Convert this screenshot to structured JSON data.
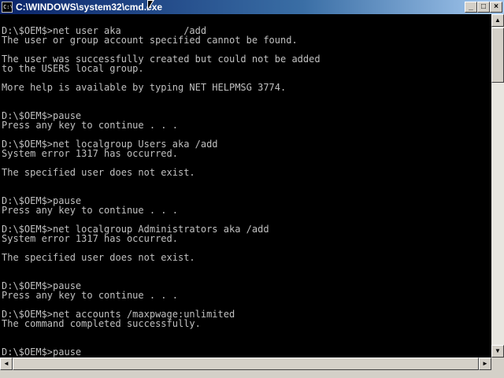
{
  "window": {
    "title": "C:\\WINDOWS\\system32\\cmd.exe",
    "icon_text": "C:\\",
    "buttons": {
      "minimize": "_",
      "maximize": "□",
      "close": "×"
    }
  },
  "console": {
    "text": "D:\\$OEM$>net user aka           /add\nThe user or group account specified cannot be found.\n\nThe user was successfully created but could not be added\nto the USERS local group.\n\nMore help is available by typing NET HELPMSG 3774.\n\n\nD:\\$OEM$>pause\nPress any key to continue . . .\n\nD:\\$OEM$>net localgroup Users aka /add\nSystem error 1317 has occurred.\n\nThe specified user does not exist.\n\n\nD:\\$OEM$>pause\nPress any key to continue . . .\n\nD:\\$OEM$>net localgroup Administrators aka /add\nSystem error 1317 has occurred.\n\nThe specified user does not exist.\n\n\nD:\\$OEM$>pause\nPress any key to continue . . .\n\nD:\\$OEM$>net accounts /maxpwage:unlimited\nThe command completed successfully.\n\n\nD:\\$OEM$>pause"
  },
  "scrollbar": {
    "up": "▲",
    "down": "▼",
    "left": "◄",
    "right": "►"
  },
  "colors": {
    "title_start": "#0a246a",
    "title_end": "#a6caf0",
    "console_bg": "#000000",
    "console_fg": "#c0c0c0"
  }
}
